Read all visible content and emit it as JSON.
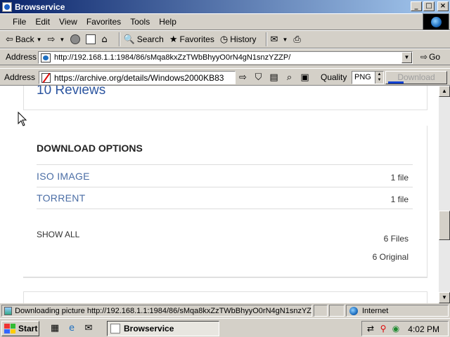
{
  "window": {
    "title": "Browservice"
  },
  "menu": [
    "File",
    "Edit",
    "View",
    "Favorites",
    "Tools",
    "Help"
  ],
  "toolbar": {
    "back": "Back",
    "search": "Search",
    "favorites": "Favorites",
    "history": "History"
  },
  "address": {
    "label": "Address",
    "url": "http://192.168.1.1:1984/86/sMqa8kxZzTWbBhyyO0rN4gN1snzYZZP/",
    "go": "Go"
  },
  "extension": {
    "label": "Address",
    "url": "https://archive.org/details/Windows2000KB83",
    "quality_label": "Quality",
    "quality_value": "PNG",
    "download_label": "Download"
  },
  "page": {
    "reviews_title": "10 Reviews",
    "download_heading": "DOWNLOAD OPTIONS",
    "options": [
      {
        "label": "ISO IMAGE",
        "count": "1 file"
      },
      {
        "label": "TORRENT",
        "count": "1 file"
      }
    ],
    "show_all": "SHOW ALL",
    "files_count": "6 Files",
    "original_count": "6 Original"
  },
  "status": {
    "text": "Downloading picture http://192.168.1.1:1984/86/sMqa8kxZzTWbBhyyO0rN4gN1snzYZ",
    "zone": "Internet"
  },
  "taskbar": {
    "start": "Start",
    "task": "Browservice",
    "clock": "4:02 PM"
  }
}
